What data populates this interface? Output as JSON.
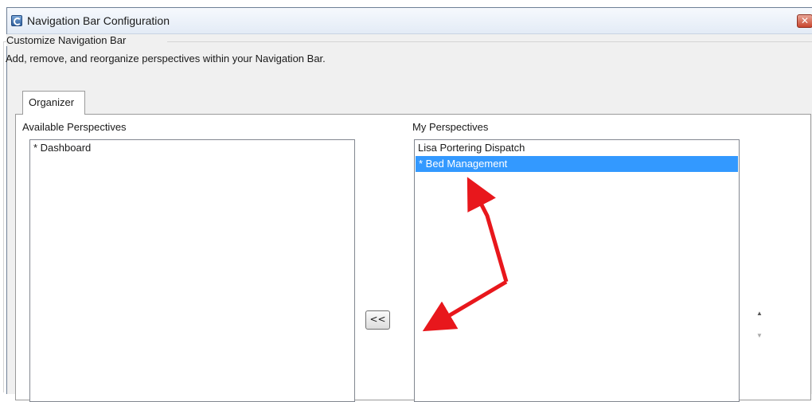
{
  "window": {
    "title": "Navigation Bar Configuration",
    "close_label": "✕"
  },
  "group": {
    "legend": "Customize Navigation Bar",
    "description": "Add, remove, and reorganize perspectives within your Navigation Bar."
  },
  "tabs": [
    {
      "label": "Organizer",
      "active": true
    }
  ],
  "available": {
    "label": "Available Perspectives",
    "items": [
      "* Dashboard"
    ]
  },
  "my": {
    "label": "My Perspectives",
    "items": [
      "Lisa Portering Dispatch",
      "* Bed Management"
    ],
    "selected_index": 1
  },
  "buttons": {
    "move_left_label": "<<",
    "move_up_label": "▲",
    "move_down_label": "▼"
  },
  "colors": {
    "selection": "#3399ff",
    "annotation_arrow": "#e8171c"
  },
  "icons": {
    "app": "app-logo-icon",
    "close": "close-icon"
  }
}
